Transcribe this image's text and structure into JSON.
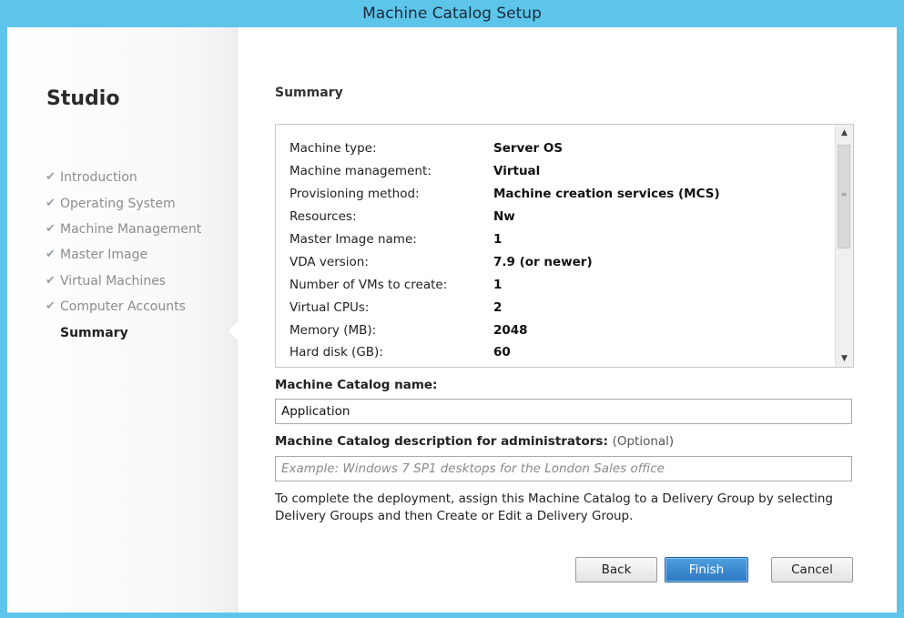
{
  "window": {
    "title": "Machine Catalog Setup"
  },
  "sidebar": {
    "title": "Studio",
    "steps": [
      {
        "label": "Introduction",
        "done": true
      },
      {
        "label": "Operating System",
        "done": true
      },
      {
        "label": "Machine Management",
        "done": true
      },
      {
        "label": "Master Image",
        "done": true
      },
      {
        "label": "Virtual Machines",
        "done": true
      },
      {
        "label": "Computer Accounts",
        "done": true
      },
      {
        "label": "Summary",
        "done": false,
        "current": true
      }
    ],
    "check_glyph": "✔"
  },
  "main": {
    "heading": "Summary",
    "summary_rows": [
      {
        "key": "Machine type:",
        "value": "Server OS"
      },
      {
        "key": "Machine management:",
        "value": "Virtual"
      },
      {
        "key": "Provisioning method:",
        "value": "Machine creation services (MCS)"
      },
      {
        "key": "Resources:",
        "value": "Nw"
      },
      {
        "key": "Master Image name:",
        "value": "1"
      },
      {
        "key": "VDA version:",
        "value": "7.9 (or newer)"
      },
      {
        "key": "Number of VMs to create:",
        "value": "1"
      },
      {
        "key": "Virtual CPUs:",
        "value": "2"
      },
      {
        "key": "Memory (MB):",
        "value": "2048"
      },
      {
        "key": "Hard disk (GB):",
        "value": "60"
      }
    ],
    "catalog_name_label": "Machine Catalog name:",
    "catalog_name_value": "Application",
    "description_label": "Machine Catalog description for administrators:",
    "description_optional": "(Optional)",
    "description_value": "",
    "description_placeholder": "Example: Windows 7 SP1 desktops for the London Sales office",
    "instructions": "To complete the deployment, assign this Machine Catalog to a Delivery Group by selecting Delivery Groups and then Create or Edit a Delivery Group."
  },
  "buttons": {
    "back": "Back",
    "finish": "Finish",
    "cancel": "Cancel"
  },
  "scrollbar": {
    "up_glyph": "▲",
    "down_glyph": "▼",
    "grip_glyph": "≡"
  },
  "colors": {
    "window_frame": "#5dc5ea",
    "finish_button": "#2c78c4"
  }
}
